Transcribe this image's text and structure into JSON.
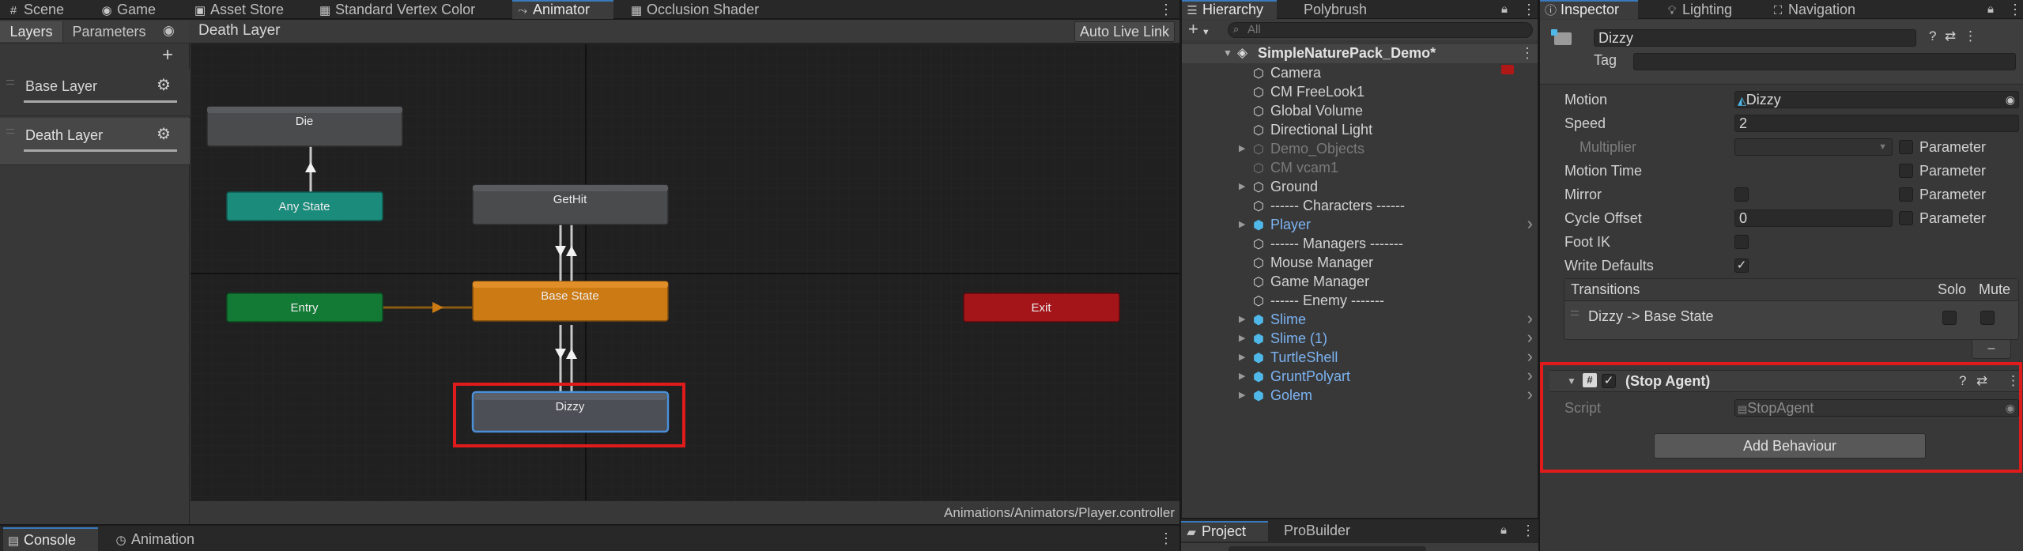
{
  "top_tabs": {
    "scene": "Scene",
    "game": "Game",
    "asset_store": "Asset Store",
    "standard_vertex_color": "Standard Vertex Color",
    "animator": "Animator",
    "occlusion_shader": "Occlusion Shader",
    "hierarchy": "Hierarchy",
    "polybrush": "Polybrush",
    "inspector": "Inspector",
    "lighting": "Lighting",
    "navigation": "Navigation"
  },
  "animator": {
    "left_tabs": {
      "layers": "Layers",
      "parameters": "Parameters"
    },
    "breadcrumb": "Death Layer",
    "auto_live_link": "Auto Live Link",
    "layers": [
      {
        "name": "Base Layer"
      },
      {
        "name": "Death Layer"
      }
    ],
    "states": {
      "die": "Die",
      "any_state": "Any State",
      "entry": "Entry",
      "gethit": "GetHit",
      "base_state": "Base State",
      "exit": "Exit",
      "dizzy": "Dizzy"
    },
    "controller_path": "Animations/Animators/Player.controller",
    "colors": {
      "graph_bg": "#202020",
      "state_gray": "#4a4b4d",
      "any_state": "#1b8b7c",
      "entry": "#137a35",
      "default_state": "#cc7a14",
      "exit": "#a4151a",
      "selected_outline": "#4a90d9",
      "highlight_box": "#e01b1b"
    }
  },
  "bottom_tabs": {
    "console": "Console",
    "animation": "Animation",
    "project": "Project",
    "probuilder": "ProBuilder"
  },
  "hierarchy": {
    "search_placeholder": "All",
    "scene_name": "SimpleNaturePack_Demo*",
    "items": [
      {
        "label": "Camera",
        "icon": "gameobject-icon",
        "type": "normal",
        "expandable": false
      },
      {
        "label": "CM FreeLook1",
        "icon": "gameobject-icon",
        "type": "normal",
        "expandable": false
      },
      {
        "label": "Global Volume",
        "icon": "gameobject-icon",
        "type": "normal",
        "expandable": false
      },
      {
        "label": "Directional Light",
        "icon": "gameobject-icon",
        "type": "normal",
        "expandable": false
      },
      {
        "label": "Demo_Objects",
        "icon": "gameobject-icon",
        "type": "disabled",
        "expandable": true
      },
      {
        "label": "CM vcam1",
        "icon": "gameobject-icon",
        "type": "disabled",
        "expandable": false
      },
      {
        "label": "Ground",
        "icon": "gameobject-icon",
        "type": "normal",
        "expandable": true
      },
      {
        "label": "------ Characters ------",
        "icon": "gameobject-icon",
        "type": "normal",
        "expandable": false
      },
      {
        "label": "Player",
        "icon": "prefab-icon",
        "type": "prefab",
        "expandable": true
      },
      {
        "label": "------ Managers -------",
        "icon": "gameobject-icon",
        "type": "normal",
        "expandable": false
      },
      {
        "label": "Mouse Manager",
        "icon": "gameobject-icon",
        "type": "normal",
        "expandable": false
      },
      {
        "label": "Game Manager",
        "icon": "gameobject-icon",
        "type": "normal",
        "expandable": false
      },
      {
        "label": "------ Enemy -------",
        "icon": "gameobject-icon",
        "type": "normal",
        "expandable": false
      },
      {
        "label": "Slime",
        "icon": "prefab-icon",
        "type": "prefab",
        "expandable": true
      },
      {
        "label": "Slime (1)",
        "icon": "prefab-icon",
        "type": "prefab",
        "expandable": true
      },
      {
        "label": "TurtleShell",
        "icon": "prefab-icon",
        "type": "prefab",
        "expandable": true
      },
      {
        "label": "GruntPolyart",
        "icon": "prefab-icon",
        "type": "prefab",
        "expandable": true
      },
      {
        "label": "Golem",
        "icon": "prefab-icon",
        "type": "prefab",
        "expandable": true
      }
    ]
  },
  "inspector": {
    "state_name": "Dizzy",
    "tag_label": "Tag",
    "motion_label": "Motion",
    "motion_value": "Dizzy",
    "speed_label": "Speed",
    "speed_value": "2",
    "multiplier_label": "Multiplier",
    "motion_time_label": "Motion Time",
    "mirror_label": "Mirror",
    "cycle_offset_label": "Cycle Offset",
    "cycle_offset_value": "0",
    "foot_ik_label": "Foot IK",
    "write_defaults_label": "Write Defaults",
    "parameter_label": "Parameter",
    "write_defaults_checked": true,
    "transitions": {
      "header": "Transitions",
      "solo": "Solo",
      "mute": "Mute",
      "items": [
        {
          "label": "Dizzy -> Base State"
        }
      ],
      "remove_symbol": "–"
    },
    "behaviour": {
      "title": "(Stop Agent)",
      "script_label": "Script",
      "script_value": "StopAgent",
      "add_behaviour": "Add Behaviour"
    }
  }
}
